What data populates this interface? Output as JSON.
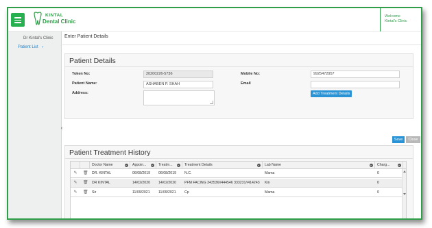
{
  "header": {
    "logo_name": "KINTAL",
    "logo_sub": "Dental Clinic",
    "welcome": "Welcome",
    "user": "Kintal's Clinic",
    "brand_color": "#2e9e48"
  },
  "sidebar": {
    "clinic": "Dr Kintal's Clinic",
    "patient_list": "Patient List",
    "patient_list_chevron": "›",
    "collapse_icon": "‹"
  },
  "page": {
    "title": "Enter Patient Details"
  },
  "patient_details": {
    "title": "Patient Details",
    "token_label": "Token No:",
    "token_value": "20200226-5736",
    "name_label": "Patient Name:",
    "name_value": "ASHABEN P. SHAH",
    "address_label": "Address:",
    "address_value": "",
    "mobile_label": "Mobile No:",
    "mobile_value": "9925472957",
    "email_label": "Email",
    "email_value": "",
    "add_treatment_label": "Add Treatment Details"
  },
  "actions": {
    "save": "Save",
    "close": "Close"
  },
  "history": {
    "title": "Patient Treatment History",
    "columns": [
      "Doctor Name",
      "Appoin...",
      "Treatm...",
      "Treatment Details",
      "Lab Name",
      "Charg..."
    ],
    "rows": [
      {
        "doctor": "DR. KINTAL",
        "appointment": "06/08/2019",
        "treatment": "06/08/2019",
        "details": "N.C.",
        "lab": "Mama",
        "charges": "0"
      },
      {
        "doctor": "DR KINTAL",
        "appointment": "14/02/2020",
        "treatment": "14/02/2020",
        "details": "PFM FACING 343536//444546 333231//414243",
        "lab": "Kin",
        "charges": "0"
      },
      {
        "doctor": "Sir",
        "appointment": "11/09/2021",
        "treatment": "11/09/2021",
        "details": "Cp",
        "lab": "Mama",
        "charges": "0"
      }
    ]
  }
}
